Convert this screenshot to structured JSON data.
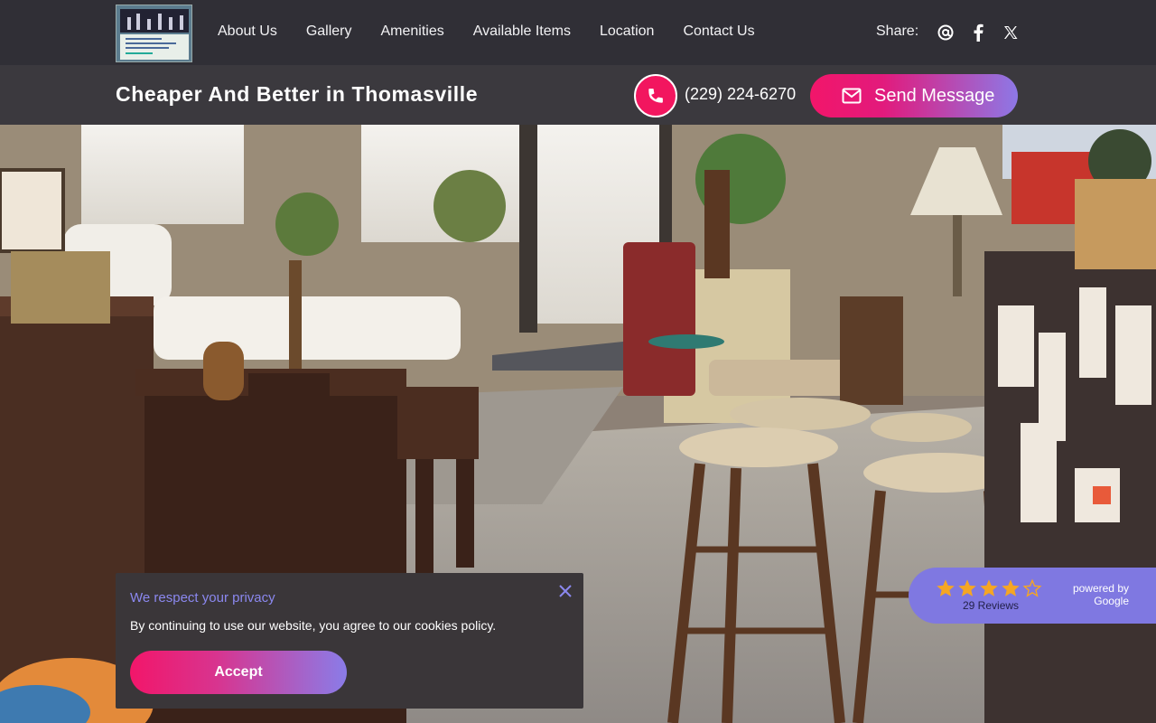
{
  "header": {
    "logo_alt": "Cheaper and Better",
    "nav": [
      {
        "label": "About Us"
      },
      {
        "label": "Gallery"
      },
      {
        "label": "Amenities"
      },
      {
        "label": "Available Items"
      },
      {
        "label": "Location"
      },
      {
        "label": "Contact Us"
      }
    ],
    "share_label": "Share:",
    "share_icons": [
      "at-icon",
      "facebook-icon",
      "x-twitter-icon"
    ]
  },
  "subbar": {
    "business_name": "Cheaper And Better in Thomasville",
    "phone": "(229) 224-6270",
    "send_message_label": "Send Message"
  },
  "cookie": {
    "title": "We respect your privacy",
    "body": "By continuing to use our website, you agree to our cookies policy.",
    "accept_label": "Accept"
  },
  "reviews": {
    "rating": 4,
    "max_rating": 5,
    "count_label": "29 Reviews",
    "powered_by_line1": "powered by",
    "powered_by_line2": "Google"
  },
  "colors": {
    "accent_pink": "#f2165f",
    "accent_purple": "#8b88ef",
    "star": "#f5a623",
    "nav_bg": "#302f36"
  }
}
